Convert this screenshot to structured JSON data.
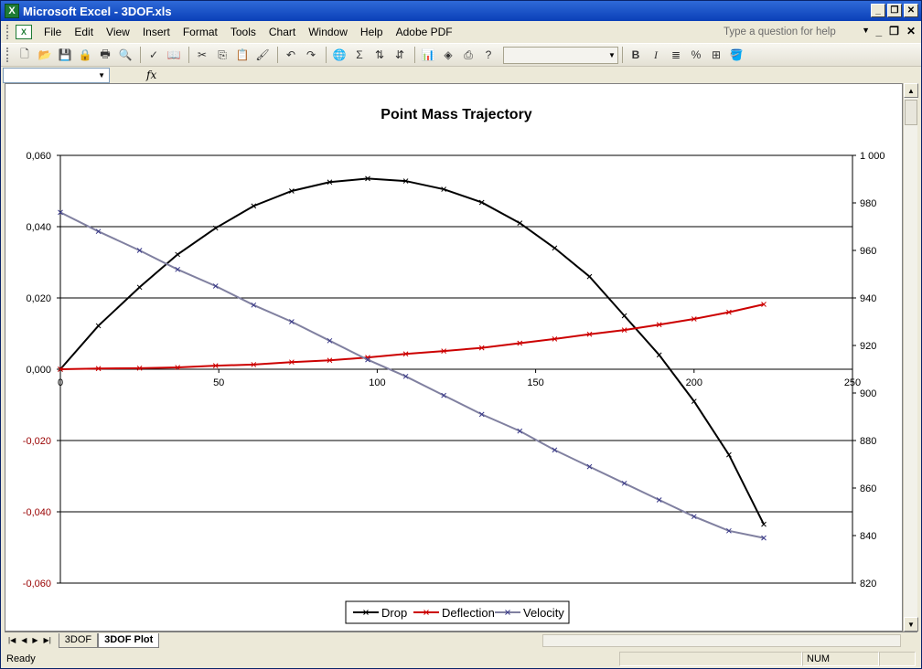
{
  "window": {
    "title": "Microsoft Excel - 3DOF.xls",
    "app_icon": "excel-icon"
  },
  "menu": {
    "items": [
      "File",
      "Edit",
      "View",
      "Insert",
      "Format",
      "Tools",
      "Chart",
      "Window",
      "Help",
      "Adobe PDF"
    ],
    "help_placeholder": "Type a question for help"
  },
  "toolbar": {
    "bold": "B",
    "italic": "I",
    "percent": "%"
  },
  "formula_bar": {
    "fx_label": "fx"
  },
  "sheet_tabs": {
    "tabs": [
      "3DOF",
      "3DOF Plot"
    ],
    "active": "3DOF Plot"
  },
  "status": {
    "left": "Ready",
    "num": "NUM"
  },
  "chart_data": {
    "type": "line",
    "title": "Point Mass Trajectory",
    "xlim": [
      0,
      250
    ],
    "x_ticks": [
      "0",
      "50",
      "100",
      "150",
      "200",
      "250"
    ],
    "ylim": [
      -0.06,
      0.06
    ],
    "y_ticks": [
      "0,060",
      "0,040",
      "0,020",
      "0,000",
      "-0,020",
      "-0,040",
      "-0,060"
    ],
    "y2lim": [
      820,
      1000
    ],
    "y2_ticks": [
      "1 000",
      "980",
      "960",
      "940",
      "920",
      "900",
      "880",
      "860",
      "840",
      "820"
    ],
    "legend": {
      "position": "bottom",
      "entries": [
        "Drop",
        "Deflection",
        "Velocity"
      ]
    },
    "grid": true,
    "colors": {
      "Drop": "#000000",
      "Deflection": "#cc0000",
      "Velocity": "#8080a0"
    },
    "series": [
      {
        "name": "Drop",
        "axis": "left",
        "x": [
          0,
          12,
          25,
          37,
          49,
          61,
          73,
          85,
          97,
          109,
          121,
          133,
          145,
          156,
          167,
          178,
          189,
          200,
          211,
          222
        ],
        "y": [
          0,
          0.0122,
          0.023,
          0.0322,
          0.0396,
          0.0458,
          0.05,
          0.0525,
          0.0535,
          0.0528,
          0.0505,
          0.0468,
          0.041,
          0.034,
          0.026,
          0.015,
          0.004,
          -0.009,
          -0.024,
          -0.0435
        ]
      },
      {
        "name": "Deflection",
        "axis": "left",
        "x": [
          0,
          12,
          25,
          37,
          49,
          61,
          73,
          85,
          97,
          109,
          121,
          133,
          145,
          156,
          167,
          178,
          189,
          200,
          211,
          222
        ],
        "y": [
          0,
          0.0002,
          0.0003,
          0.0005,
          0.001,
          0.0013,
          0.002,
          0.0025,
          0.0033,
          0.0043,
          0.0051,
          0.006,
          0.0073,
          0.0085,
          0.0098,
          0.011,
          0.0125,
          0.0141,
          0.016,
          0.0182
        ]
      },
      {
        "name": "Velocity",
        "axis": "right",
        "x": [
          0,
          12,
          25,
          37,
          49,
          61,
          73,
          85,
          97,
          109,
          121,
          133,
          145,
          156,
          167,
          178,
          189,
          200,
          211,
          222
        ],
        "y": [
          976,
          968,
          960,
          952,
          945,
          937,
          930,
          922,
          914,
          907,
          899,
          891,
          884,
          876,
          869,
          862,
          855,
          848,
          842,
          839
        ]
      }
    ]
  }
}
